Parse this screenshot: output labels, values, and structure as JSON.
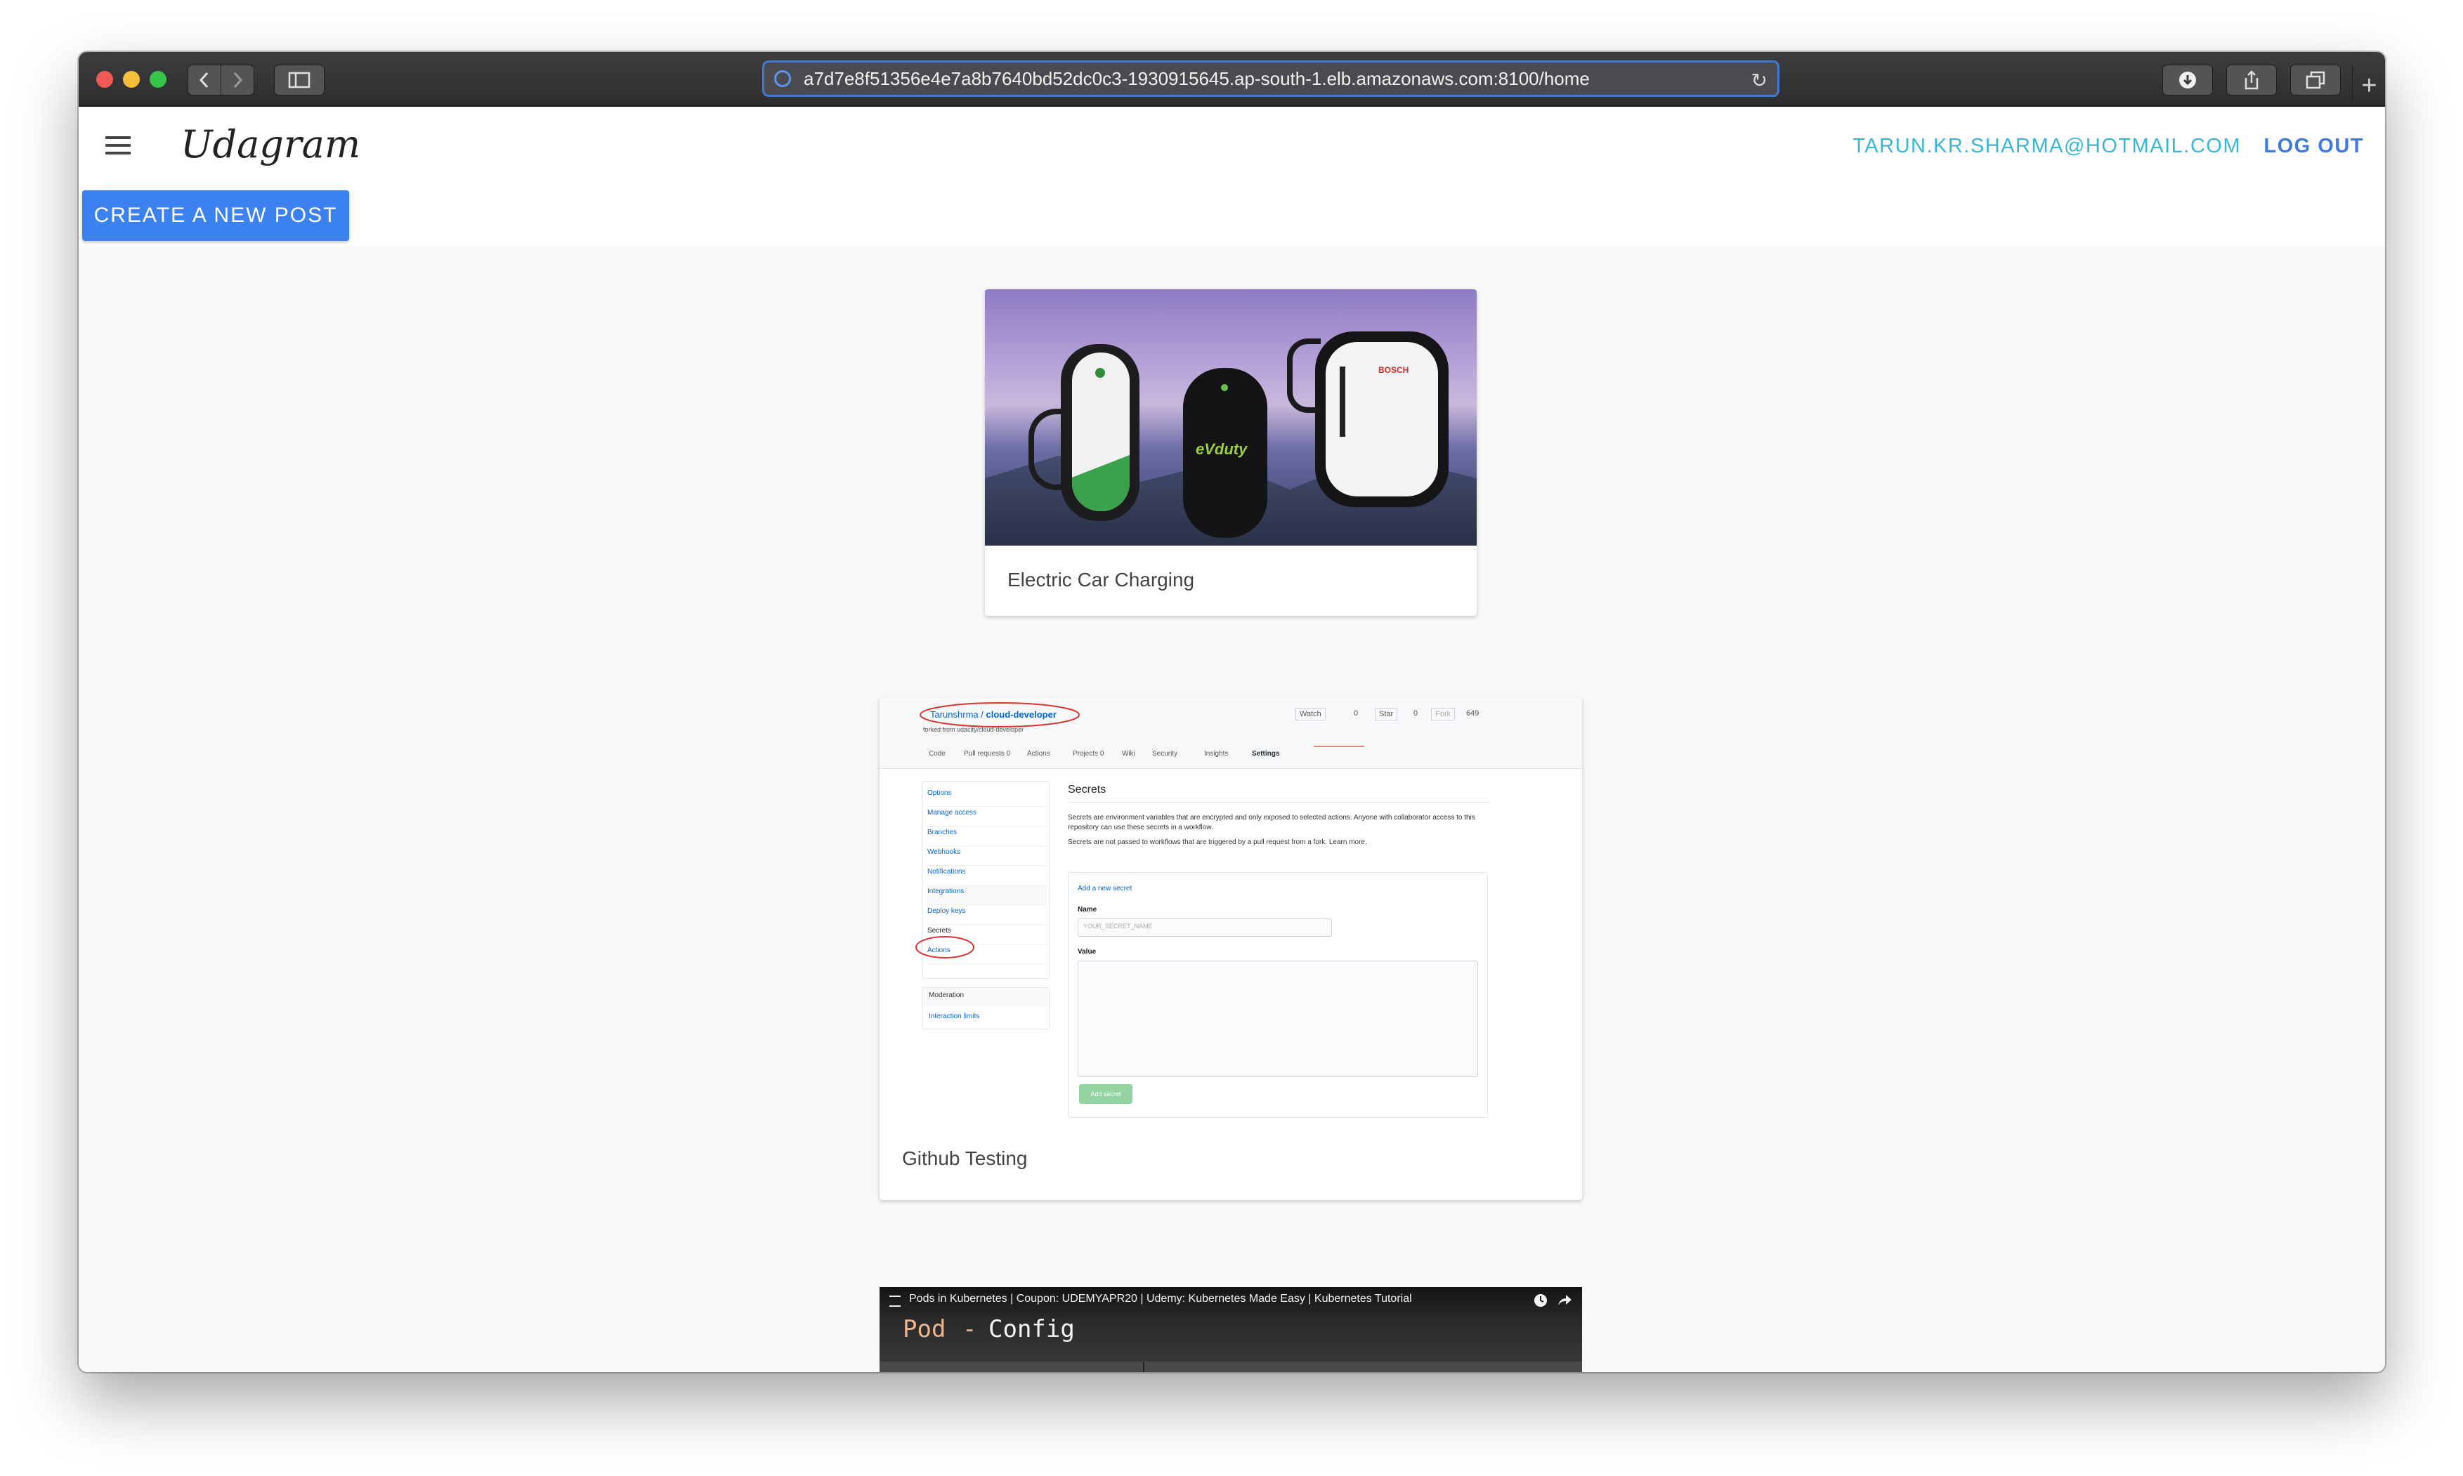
{
  "browser": {
    "url": "a7d7e8f51356e4e7a8b7640bd52dc0c3-1930915645.ap-south-1.elb.amazonaws.com:8100/home",
    "traffic_lights": [
      "#ee5b57",
      "#f4bd3a",
      "#37c449"
    ]
  },
  "header": {
    "brand": "Udagram",
    "user_email": "TARUN.KR.SHARMA@HOTMAIL.COM",
    "logout_label": "LOG OUT"
  },
  "actions": {
    "create_post_label": "CREATE A NEW POST"
  },
  "feed": [
    {
      "caption": "Electric Car Charging",
      "charger_labels": {
        "bosch": "BOSCH",
        "evduty": "eVduty"
      }
    },
    {
      "caption": "Github Testing",
      "screenshot": {
        "repo_owner": "Tarunshrma",
        "repo_name": "cloud-developer",
        "forked_from": "forked from udacity/cloud-developer",
        "watch": "Watch",
        "watch_count": "0",
        "star": "Star",
        "star_count": "0",
        "fork": "Fork",
        "fork_count": "649",
        "tabs": [
          "Code",
          "Pull requests 0",
          "Actions",
          "Projects 0",
          "Wiki",
          "Security",
          "Insights",
          "Settings"
        ],
        "menu": [
          "Options",
          "Manage access",
          "Branches",
          "Webhooks",
          "Notifications",
          "Integrations",
          "Deploy keys",
          "Secrets",
          "Actions"
        ],
        "menu_group2_title": "Moderation",
        "menu_group2": [
          "Interaction limits"
        ],
        "section_title": "Secrets",
        "desc1": "Secrets are environment variables that are encrypted and only exposed to selected actions. Anyone with collaborator access to this repository can use these secrets in a workflow.",
        "desc2": "Secrets are not passed to workflows that are triggered by a pull request from a fork. Learn more.",
        "add_link": "Add a new secret",
        "name_label": "Name",
        "name_placeholder": "YOUR_SECRET_NAME",
        "value_label": "Value",
        "add_button": "Add secret"
      }
    },
    {
      "video_title": "Pods in Kubernetes | Coupon: UDEMYAPR20 | Udemy: Kubernetes Made Easy | Kubernetes Tutorial",
      "slide_word1": "Pod",
      "slide_sep": "-",
      "slide_word2": "Config"
    }
  ]
}
